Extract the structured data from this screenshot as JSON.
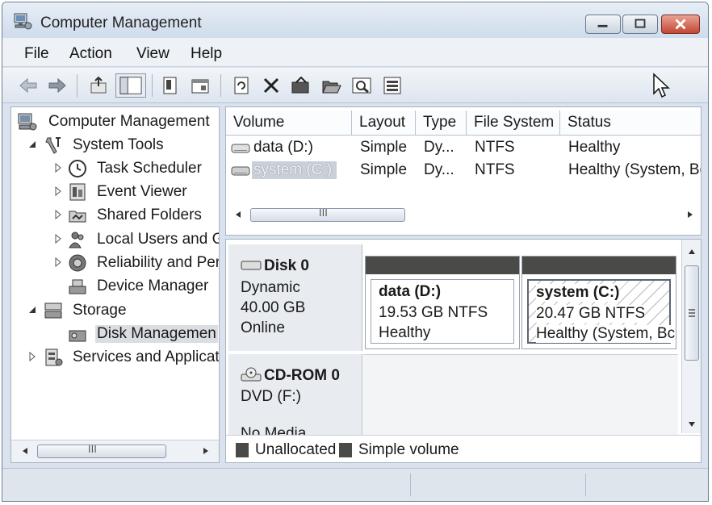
{
  "window": {
    "title": "Computer Management"
  },
  "menu": [
    "File",
    "Action",
    "View",
    "Help"
  ],
  "toolbar": {
    "buttons": [
      "back-arrow-icon",
      "forward-arrow-icon",
      "up-folder-icon",
      "show-hide-tree-icon",
      "properties-icon",
      "help-icon",
      "refresh-icon",
      "delete-icon",
      "connect-icon",
      "open-icon",
      "search-icon",
      "export-icon"
    ]
  },
  "tree": {
    "items": [
      {
        "label": "Computer Management",
        "icon": "computer-management-icon"
      },
      {
        "label": "System Tools",
        "icon": "tools-icon"
      },
      {
        "label": "Task Scheduler",
        "icon": "clock-icon"
      },
      {
        "label": "Event Viewer",
        "icon": "event-viewer-icon"
      },
      {
        "label": "Shared Folders",
        "icon": "shared-folder-icon"
      },
      {
        "label": "Local Users and G",
        "icon": "users-icon"
      },
      {
        "label": "Reliability and Per",
        "icon": "performance-icon"
      },
      {
        "label": "Device Manager",
        "icon": "device-manager-icon"
      },
      {
        "label": "Storage",
        "icon": "storage-icon"
      },
      {
        "label": "Disk Managemen",
        "icon": "disk-management-icon"
      },
      {
        "label": "Services and Applicat",
        "icon": "services-icon"
      }
    ],
    "scroll_grip": "III"
  },
  "volume_list": {
    "columns": [
      "Volume",
      "Layout",
      "Type",
      "File System",
      "Status"
    ],
    "rows": [
      {
        "volume": "data (D:)",
        "layout": "Simple",
        "type": "Dy...",
        "fs": "NTFS",
        "status": "Healthy"
      },
      {
        "volume": "system (C:)",
        "layout": "Simple",
        "type": "Dy...",
        "fs": "NTFS",
        "status": "Healthy (System, Bc"
      }
    ],
    "scroll_grip": "III"
  },
  "disks": [
    {
      "name": "Disk 0",
      "kind": "Dynamic",
      "size": "40.00 GB",
      "state": "Online",
      "partitions": [
        {
          "name": "data  (D:)",
          "size": "19.53 GB NTFS",
          "status": "Healthy"
        },
        {
          "name": "system  (C:)",
          "size": "20.47 GB NTFS",
          "status": "Healthy (System, Bc"
        }
      ]
    },
    {
      "name": "CD-ROM 0",
      "kind": "DVD (F:)",
      "state": "No Media"
    }
  ],
  "legend": [
    "Unallocated",
    "Simple volume"
  ],
  "colors": {
    "partition_header": "#4a4a48",
    "selection": "#c9d0d9"
  }
}
